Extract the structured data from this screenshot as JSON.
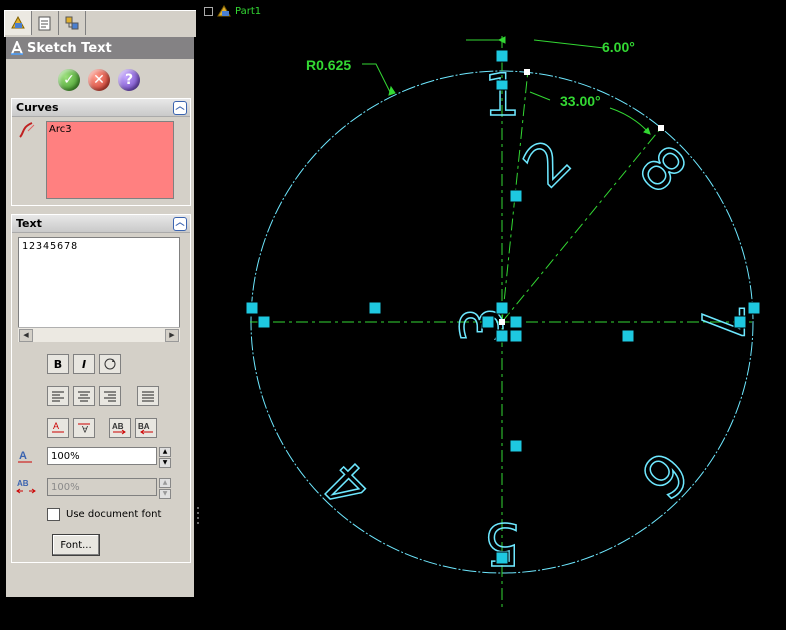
{
  "panel_title": "Sketch Text",
  "ok_symbol": "✓",
  "cancel_symbol": "✕",
  "help_symbol": "?",
  "curves": {
    "header": "Curves",
    "items": [
      "Arc3"
    ]
  },
  "text_group": {
    "header": "Text",
    "value": "12345678",
    "bold": "B",
    "italic": "I",
    "width_factor": "100%",
    "spacing": "100%",
    "use_doc_font_label": "Use document font",
    "use_doc_font_checked": false,
    "font_button": "Font..."
  },
  "tree_root": "Part1",
  "dimensions": {
    "radius": "R0.625",
    "angle_small": "6.00°",
    "angle_large": "33.00°"
  },
  "colors": {
    "sketch": "#6ee8ff",
    "dimension": "#33d833",
    "curve_highlight": "#ff8080",
    "panel": "#d4d0c8"
  }
}
